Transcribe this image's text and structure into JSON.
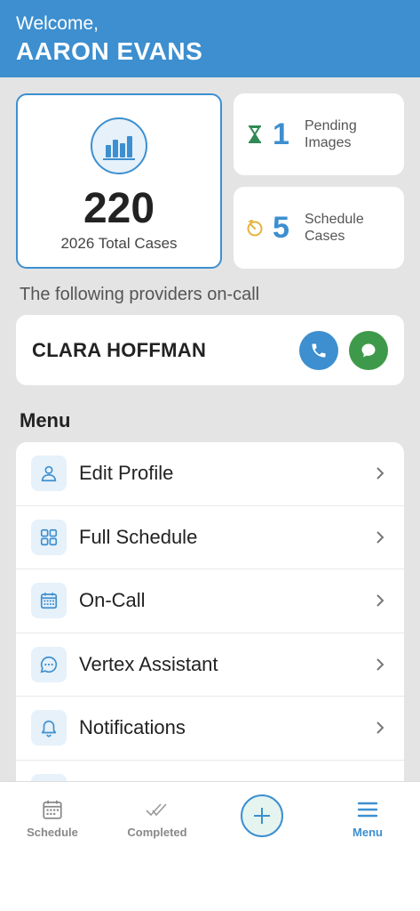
{
  "header": {
    "welcome": "Welcome,",
    "user_name": "AARON EVANS"
  },
  "stats": {
    "total": {
      "count": "220",
      "label": "2026 Total Cases",
      "icon": "bar-chart-icon"
    },
    "pending": {
      "count": "1",
      "label_line1": "Pending",
      "label_line2": "Images",
      "icon": "hourglass-icon"
    },
    "schedule": {
      "count": "5",
      "label_line1": "Schedule",
      "label_line2": "Cases",
      "icon": "timer-icon"
    }
  },
  "providers": {
    "caption": "The following providers on-call",
    "name": "CLARA HOFFMAN"
  },
  "menu": {
    "heading": "Menu",
    "items": [
      {
        "label": "Edit Profile",
        "icon": "user-icon"
      },
      {
        "label": "Full Schedule",
        "icon": "grid-icon"
      },
      {
        "label": "On-Call",
        "icon": "calendar-icon"
      },
      {
        "label": "Vertex Assistant",
        "icon": "chat-icon"
      },
      {
        "label": "Notifications",
        "icon": "bell-icon"
      }
    ]
  },
  "bottom_nav": {
    "schedule": "Schedule",
    "completed": "Completed",
    "menu": "Menu"
  },
  "colors": {
    "primary": "#3d8fcf",
    "green": "#3e9a4a",
    "background": "#e4e4e4",
    "pending_icon": "#2f8a55",
    "schedule_icon": "#e6b33b"
  }
}
